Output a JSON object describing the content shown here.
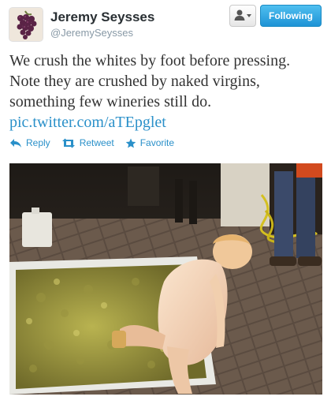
{
  "user": {
    "name": "Jeremy Seysses",
    "handle": "@JeremySeysses",
    "avatar_icon": "grapes-avatar-icon"
  },
  "follow_button": {
    "label": "Following"
  },
  "user_menu": {
    "icon": "person-dropdown-icon"
  },
  "tweet": {
    "lines": [
      "We crush the whites by foot before pressing.",
      "Note they are crushed by naked virgins,",
      "something few wineries still do."
    ],
    "link": "pic.twitter.com/aTEpglet"
  },
  "actions": [
    {
      "label": "Reply",
      "icon": "reply-arrow-icon"
    },
    {
      "label": "Retweet",
      "icon": "retweet-icon"
    },
    {
      "label": "Favorite",
      "icon": "star-icon"
    }
  ],
  "photo": {
    "subject": "grape-crushing-photo"
  },
  "colors": {
    "link": "#2a90c9",
    "follow_button": "#2a9be0",
    "handle": "#8899a6",
    "name": "#292f33"
  }
}
